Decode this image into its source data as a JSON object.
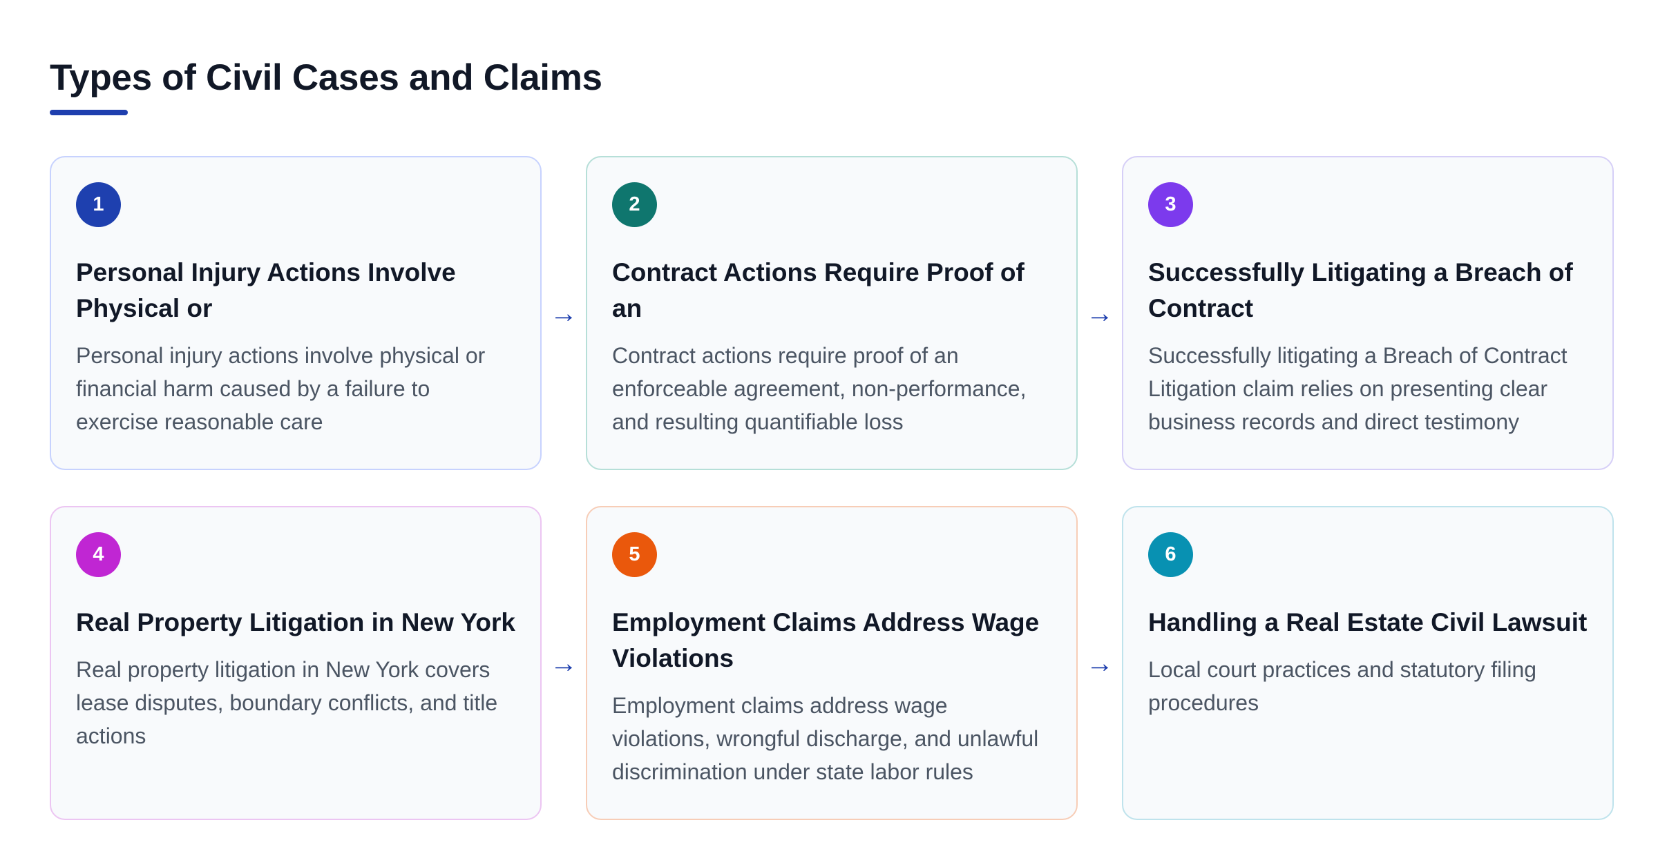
{
  "title": "Types of Civil Cases and Claims",
  "arrow_glyph": "→",
  "cards": [
    {
      "number": "1",
      "color": "#1e40af",
      "border": "#c7d2fe",
      "heading": "Personal Injury Actions Involve Physical or",
      "body": "Personal injury actions involve physical or financial harm caused by a failure to exercise reasonable care"
    },
    {
      "number": "2",
      "color": "#0f766e",
      "border": "#b6dfd8",
      "heading": "Contract Actions Require Proof of an",
      "body": "Contract actions require proof of an enforceable agreement, non-performance, and resulting quantifiable loss"
    },
    {
      "number": "3",
      "color": "#7c3aed",
      "border": "#d6cff7",
      "heading": "Successfully Litigating a Breach of Contract",
      "body": "Successfully litigating a Breach of Contract Litigation claim relies on presenting clear business records and direct testimony"
    },
    {
      "number": "4",
      "color": "#c026d3",
      "border": "#ecc5f2",
      "heading": "Real Property Litigation in New York",
      "body": "Real property litigation in New York covers lease disputes, boundary conflicts, and title actions"
    },
    {
      "number": "5",
      "color": "#ea580c",
      "border": "#f7cdb7",
      "heading": "Employment Claims Address Wage Violations",
      "body": "Employment claims address wage violations, wrongful discharge, and unlawful discrimination under state labor rules"
    },
    {
      "number": "6",
      "color": "#0891b2",
      "border": "#bfe3ec",
      "heading": "Handling a Real Estate Civil Lawsuit",
      "body": "Local court practices and statutory filing procedures"
    }
  ]
}
